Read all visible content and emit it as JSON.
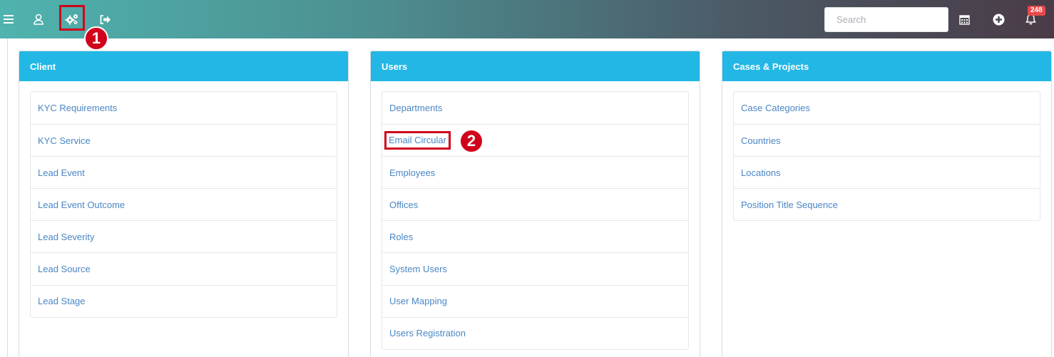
{
  "topbar": {
    "search_placeholder": "Search",
    "notification_count": "248",
    "step1": "1",
    "icons": [
      "menu-icon",
      "user-icon",
      "gears-icon",
      "sign-out-icon",
      "calendar-icon",
      "plus-circle-icon",
      "bell-icon"
    ],
    "highlight_color": "#d0021b"
  },
  "panels": {
    "client": {
      "title": "Client",
      "items": [
        "KYC Requirements",
        "KYC Service",
        "Lead Event",
        "Lead Event Outcome",
        "Lead Severity",
        "Lead Source",
        "Lead Stage"
      ]
    },
    "users": {
      "title": "Users",
      "items": [
        "Departments",
        "Email Circular",
        "Employees",
        "Offices",
        "Roles",
        "System Users",
        "User Mapping",
        "Users Registration"
      ],
      "step2": "2"
    },
    "cases": {
      "title": "Cases & Projects",
      "items": [
        "Case Categories",
        "Countries",
        "Locations",
        "Position Title Sequence"
      ]
    }
  },
  "colors": {
    "header_blue": "#23b7e5",
    "link_blue": "#4a86c5",
    "badge_red": "#e84a4a"
  }
}
